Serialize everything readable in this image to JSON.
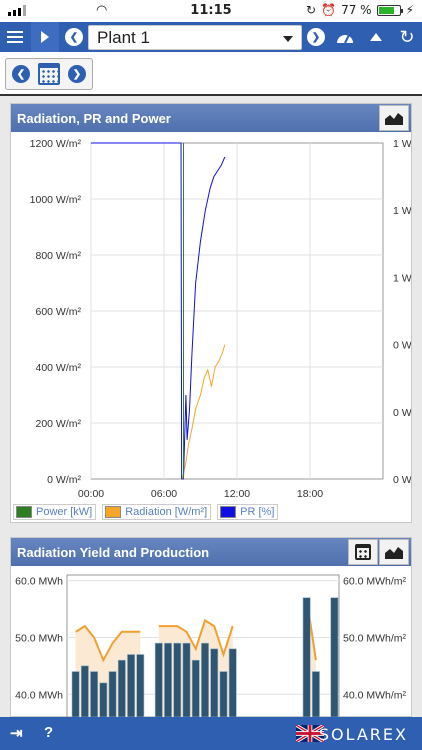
{
  "status": {
    "time": "11:15",
    "battery": "77 %",
    "battery_level": 0.77
  },
  "toolbar": {
    "plant": "Plant 1"
  },
  "panels": {
    "rpp": {
      "title": "Radiation, PR and Power"
    },
    "ryp": {
      "title": "Radiation Yield and Production"
    }
  },
  "chart_rpp": {
    "type": "line",
    "x_ticks": [
      "00:00",
      "06:00",
      "12:00",
      "18:00"
    ],
    "y_left_ticks": [
      "1200 W/m²",
      "1000 W/m²",
      "800 W/m²",
      "600 W/m²",
      "400 W/m²",
      "200 W/m²",
      "0 W/m²"
    ],
    "y_right_ticks": [
      "1 W",
      "1 W",
      "1 W",
      "0 W",
      "0 W",
      "0 W"
    ],
    "legend": [
      {
        "label": "Power [kW]",
        "color": "#2e7d20"
      },
      {
        "label": "Radiation [W/m²]",
        "color": "#f4a62a"
      },
      {
        "label": "PR [%]",
        "color": "#1010e0"
      }
    ]
  },
  "chart_ryp": {
    "type": "bar",
    "y_left_ticks": [
      "60.0 MWh",
      "50.0 MWh",
      "40.0 MWh"
    ],
    "y_right_ticks": [
      "60.0 MWh/m²",
      "50.0 MWh/m²",
      "40.0 MWh/m²"
    ]
  },
  "chart_data": [
    {
      "type": "line",
      "title": "Radiation, PR and Power",
      "xlim": [
        0,
        24
      ],
      "x_ticks": [
        "00:00",
        "06:00",
        "12:00",
        "18:00"
      ],
      "ylim": [
        0,
        1200
      ],
      "series": [
        {
          "name": "Radiation [W/m²]",
          "color": "#f4a62a",
          "x": [
            7.3,
            7.5,
            7.8,
            8.0,
            8.3,
            8.6,
            9.0,
            9.3,
            9.6,
            9.9,
            10.2,
            10.5,
            10.8,
            11.0
          ],
          "y": [
            0,
            0,
            60,
            120,
            180,
            250,
            300,
            360,
            390,
            330,
            400,
            420,
            450,
            480
          ]
        },
        {
          "name": "PR [%]",
          "color": "#1010e0",
          "x": [
            0,
            7.4,
            7.45,
            7.6,
            7.8,
            7.9,
            8.1,
            8.3,
            8.6,
            9.0,
            9.4,
            9.8,
            10.1,
            10.4,
            10.7,
            11.0
          ],
          "y": [
            1200,
            1200,
            0,
            0,
            300,
            140,
            250,
            450,
            700,
            850,
            960,
            1040,
            1080,
            1100,
            1120,
            1150
          ]
        },
        {
          "name": "Power [kW]",
          "color": "#2e7d20",
          "x": [
            7.6,
            7.6
          ],
          "y": [
            1200,
            0
          ]
        }
      ]
    },
    {
      "type": "bar",
      "title": "Radiation Yield and Production",
      "ylim": [
        36,
        61
      ],
      "series": [
        {
          "name": "Production",
          "values": [
            44,
            45,
            44,
            42,
            44,
            46,
            47,
            47,
            0,
            49,
            49,
            49,
            49,
            46,
            49,
            48,
            44,
            48,
            0,
            0,
            0,
            0,
            0,
            0,
            0,
            57,
            44,
            0,
            57
          ]
        },
        {
          "name": "Radiation yield",
          "values": [
            51,
            52,
            50,
            46,
            49,
            51,
            51,
            51,
            0,
            52,
            52,
            52,
            51,
            48,
            53,
            52,
            47,
            52,
            0,
            0,
            0,
            0,
            0,
            0,
            0,
            57,
            46,
            0,
            0
          ]
        }
      ]
    }
  ]
}
